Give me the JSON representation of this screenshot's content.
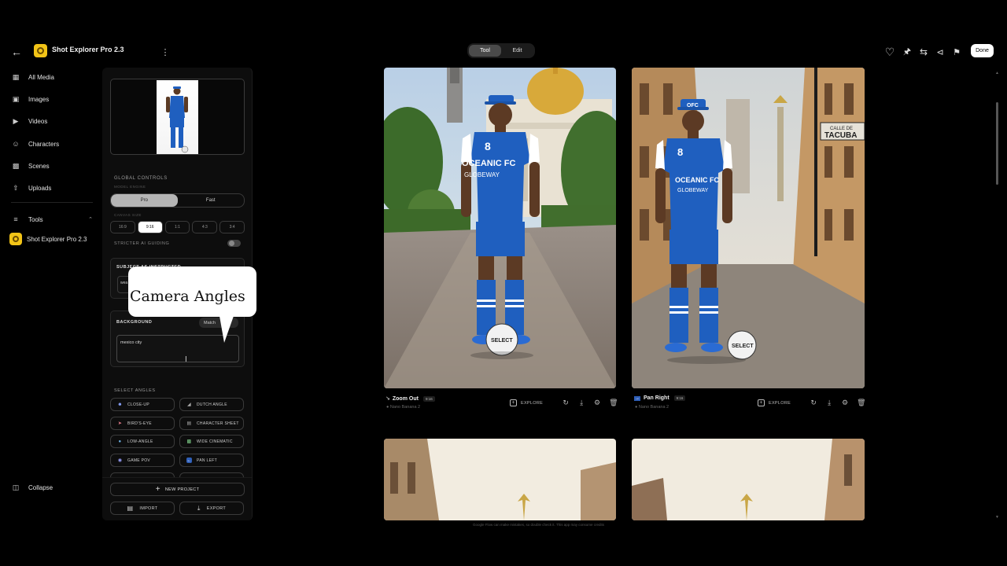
{
  "header": {
    "app_title": "Shot Explorer Pro 2.3",
    "mode_tabs": [
      "Tool",
      "Edit"
    ],
    "done_label": "Done"
  },
  "nav": {
    "items": [
      {
        "label": "All Media",
        "icon": "grid-icon"
      },
      {
        "label": "Images",
        "icon": "image-icon"
      },
      {
        "label": "Videos",
        "icon": "video-icon"
      },
      {
        "label": "Characters",
        "icon": "person-icon"
      },
      {
        "label": "Scenes",
        "icon": "film-icon"
      },
      {
        "label": "Uploads",
        "icon": "upload-icon"
      }
    ],
    "tools_label": "Tools",
    "tool_item": "Shot Explorer Pro 2.3",
    "collapse_label": "Collapse"
  },
  "panel": {
    "global_controls": "GLOBAL CONTROLS",
    "model_engine": "MODEL ENGINE",
    "engine_options": [
      "Pro",
      "Fast"
    ],
    "canvas_size": "CANVAS SIZE",
    "canvas_options": [
      "16:9",
      "9:16",
      "1:1",
      "4:3",
      "3:4"
    ],
    "stricter": "STRICTER AI GUIDING",
    "subject_title": "SUBJECT AS INSTRUCTED",
    "subject_value": "wea",
    "background_title": "BACKGROUND",
    "match_label": "Match",
    "background_value": "mexico city",
    "select_angles": "SELECT ANGLES",
    "angles": [
      "CLOSE-UP",
      "DUTCH ANGLE",
      "BIRD'S-EYE",
      "CHARACTER SHEET",
      "LOW-ANGLE",
      "WIDE CINEMATIC",
      "GAME POV",
      "PAN LEFT"
    ],
    "new_project": "NEW PROJECT",
    "import": "IMPORT",
    "export": "EXPORT"
  },
  "callout": {
    "text": "Camera Angles"
  },
  "gallery": {
    "cards": [
      {
        "title": "Zoom Out",
        "badge": "9:16",
        "model": "Nano Banana 2",
        "explore": "EXPLORE"
      },
      {
        "title": "Pan Right",
        "badge": "9:16",
        "model": "Nano Banana 2",
        "explore": "EXPLORE"
      }
    ]
  },
  "jersey": {
    "number": "8",
    "team": "OCEANIC FC",
    "sponsor": "GLOBEWAY",
    "cap": "OFC",
    "ball": "SELECT"
  },
  "street_sign": {
    "line1": "CALLE DE",
    "line2": "TACUBA"
  },
  "disclaimer": "Google Flow can make mistakes, so double check it. This app may consume credits"
}
